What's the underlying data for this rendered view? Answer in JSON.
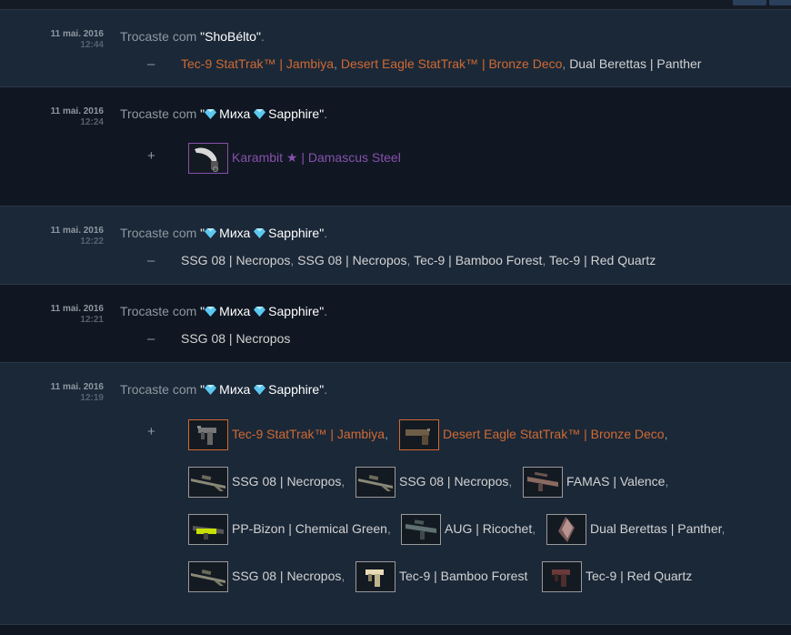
{
  "trade_history": [
    {
      "date": "11 mai. 2016",
      "time": "12:44",
      "prefix": "Trocaste com ",
      "partner": "\"ShoBélto\"",
      "partner_gems": false,
      "suffix": ".",
      "sign": "–",
      "items_text": [
        {
          "label": "Tec-9 StatTrak™ | Jambiya",
          "quality": "stattrak",
          "sep": ", "
        },
        {
          "label": "Desert Eagle StatTrak™ | Bronze Deco",
          "quality": "stattrak",
          "sep": ", "
        },
        {
          "label": "Dual Berettas | Panther",
          "quality": "plain",
          "sep": ""
        }
      ]
    },
    {
      "date": "11 mai. 2016",
      "time": "12:24",
      "prefix": "Trocaste com ",
      "partner_open": "\"",
      "partner_name_1": "Миха",
      "partner_name_2": "Sapphire",
      "partner_close": "\"",
      "partner_gems": true,
      "suffix": ".",
      "sign": "+",
      "items": [
        {
          "label": "Karambit ★ | Damascus Steel",
          "quality": "knife",
          "icon": "karambit-icon",
          "sep": ""
        }
      ]
    },
    {
      "date": "11 mai. 2016",
      "time": "12:22",
      "prefix": "Trocaste com ",
      "partner_open": "\"",
      "partner_name_1": "Миха",
      "partner_name_2": "Sapphire",
      "partner_close": "\"",
      "partner_gems": true,
      "suffix": ".",
      "sign": "–",
      "items_text": [
        {
          "label": "SSG 08 | Necropos",
          "quality": "plain",
          "sep": ", "
        },
        {
          "label": "SSG 08 | Necropos",
          "quality": "plain",
          "sep": ", "
        },
        {
          "label": "Tec-9 | Bamboo Forest",
          "quality": "plain",
          "sep": ", "
        },
        {
          "label": "Tec-9 | Red Quartz",
          "quality": "plain",
          "sep": ""
        }
      ]
    },
    {
      "date": "11 mai. 2016",
      "time": "12:21",
      "prefix": "Trocaste com ",
      "partner_open": "\"",
      "partner_name_1": "Миха",
      "partner_name_2": "Sapphire",
      "partner_close": "\"",
      "partner_gems": true,
      "suffix": ".",
      "sign": "–",
      "items_text": [
        {
          "label": "SSG 08 | Necropos",
          "quality": "plain",
          "sep": ""
        }
      ]
    },
    {
      "date": "11 mai. 2016",
      "time": "12:19",
      "prefix": "Trocaste com ",
      "partner_open": "\"",
      "partner_name_1": "Миха",
      "partner_name_2": "Sapphire",
      "partner_close": "\"",
      "partner_gems": true,
      "suffix": ".",
      "sign": "+",
      "items": [
        {
          "label": "Tec-9 StatTrak™ | Jambiya",
          "quality": "stattrak",
          "icon": "tec9-icon",
          "sep": ","
        },
        {
          "label": "Desert Eagle StatTrak™ | Bronze Deco",
          "quality": "stattrak",
          "icon": "deagle-icon",
          "sep": ","
        },
        {
          "label": "SSG 08 | Necropos",
          "quality": "plain",
          "icon": "sniper-rifle-icon",
          "sep": ","
        },
        {
          "label": "SSG 08 | Necropos",
          "quality": "plain",
          "icon": "sniper-rifle-icon",
          "sep": ","
        },
        {
          "label": "FAMAS | Valence",
          "quality": "plain",
          "icon": "famas-icon",
          "sep": ","
        },
        {
          "label": "PP-Bizon | Chemical Green",
          "quality": "plain",
          "icon": "smg-icon",
          "sep": ","
        },
        {
          "label": "AUG | Ricochet",
          "quality": "plain",
          "icon": "aug-icon",
          "sep": ","
        },
        {
          "label": "Dual Berettas | Panther",
          "quality": "plain",
          "icon": "dual-berettas-icon",
          "sep": ","
        },
        {
          "label": "SSG 08 | Necropos",
          "quality": "plain",
          "icon": "sniper-rifle-icon",
          "sep": ","
        },
        {
          "label": "Tec-9 | Bamboo Forest",
          "quality": "plain",
          "icon": "tec9-bamboo-icon",
          "sep": ""
        },
        {
          "label": "Tec-9 | Red Quartz",
          "quality": "plain",
          "icon": "tec9-red-icon",
          "sep": ""
        }
      ]
    }
  ],
  "colors": {
    "stattrak": "#cf6a32",
    "knife": "#8650ac",
    "plain": "#d2d2d2",
    "gem": "#5cc8f0"
  }
}
